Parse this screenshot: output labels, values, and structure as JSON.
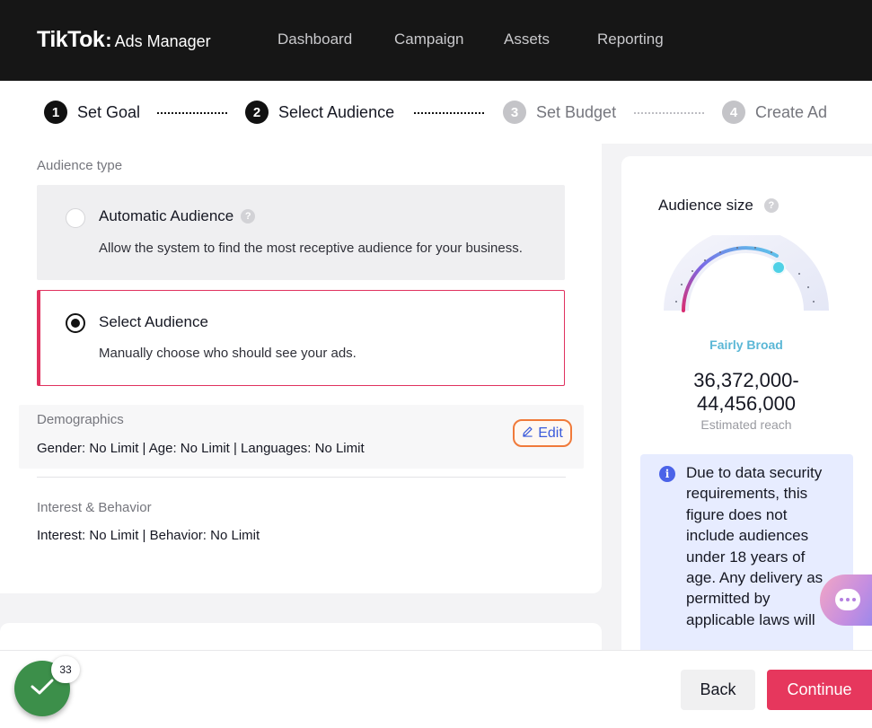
{
  "header": {
    "brand": "TikTok",
    "brand_colon": ":",
    "product": "Ads Manager",
    "nav": [
      "Dashboard",
      "Campaign",
      "Assets",
      "Reporting"
    ]
  },
  "stepper": {
    "steps": [
      {
        "num": "1",
        "label": "Set Goal",
        "active": true
      },
      {
        "num": "2",
        "label": "Select Audience",
        "active": true
      },
      {
        "num": "3",
        "label": "Set Budget",
        "active": false
      },
      {
        "num": "4",
        "label": "Create Ad",
        "active": false
      }
    ]
  },
  "audience_type": {
    "label": "Audience type",
    "options": [
      {
        "title": "Automatic Audience",
        "desc": "Allow the system to find the most receptive audience for your business.",
        "selected": false
      },
      {
        "title": "Select Audience",
        "desc": "Manually choose who should see your ads.",
        "selected": true
      }
    ],
    "help_glyph": "?"
  },
  "demographics": {
    "label": "Demographics",
    "value": "Gender: No Limit | Age: No Limit | Languages: No Limit",
    "edit_label": "Edit"
  },
  "interest": {
    "label": "Interest & Behavior",
    "value": "Interest: No Limit | Behavior: No Limit"
  },
  "audience_size": {
    "title": "Audience size",
    "gauge_level": 0.7,
    "level_label": "Fairly Broad",
    "reach_line1": "36,372,000-",
    "reach_line2": "44,456,000",
    "reach_caption": "Estimated reach",
    "info_text": "Due to data security requirements, this figure does not include audiences under 18 years of age. Any delivery as permitted by applicable laws will"
  },
  "footer": {
    "badge_count": "33",
    "back_label": "Back",
    "continue_label": "Continue"
  },
  "colors": {
    "accent": "#e6375d",
    "edit_link": "#3b5bdb",
    "gauge_dot": "#4fd1e6",
    "info_bg": "#e7ecff",
    "success": "#3c8f4a"
  }
}
